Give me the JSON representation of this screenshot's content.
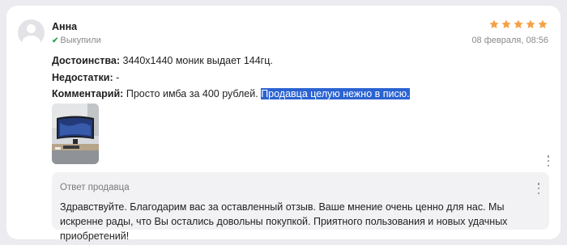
{
  "review": {
    "author": "Анна",
    "purchase_status": "Выкупили",
    "rating": 5,
    "date": "08 февраля, 08:56",
    "advantages_label": "Достоинства:",
    "advantages_text": "3440x1440 моник выдает 144гц.",
    "disadvantages_label": "Недостатки:",
    "disadvantages_text": "-",
    "comment_label": "Комментарий:",
    "comment_text": "Просто имба за 400 рублей.",
    "comment_selected": "Продавца целую нежно в писю."
  },
  "seller_reply": {
    "title": "Ответ продавца",
    "text": "Здравствуйте. Благодарим вас за оставленный отзыв. Ваше мнение очень ценно для нас. Мы искренне рады, что Вы остались довольны покупкой. Приятного пользования и новых удачных приобретений!"
  },
  "colors": {
    "star": "#f5a148",
    "selection": "#2b63d1",
    "check": "#2eaa4f"
  }
}
